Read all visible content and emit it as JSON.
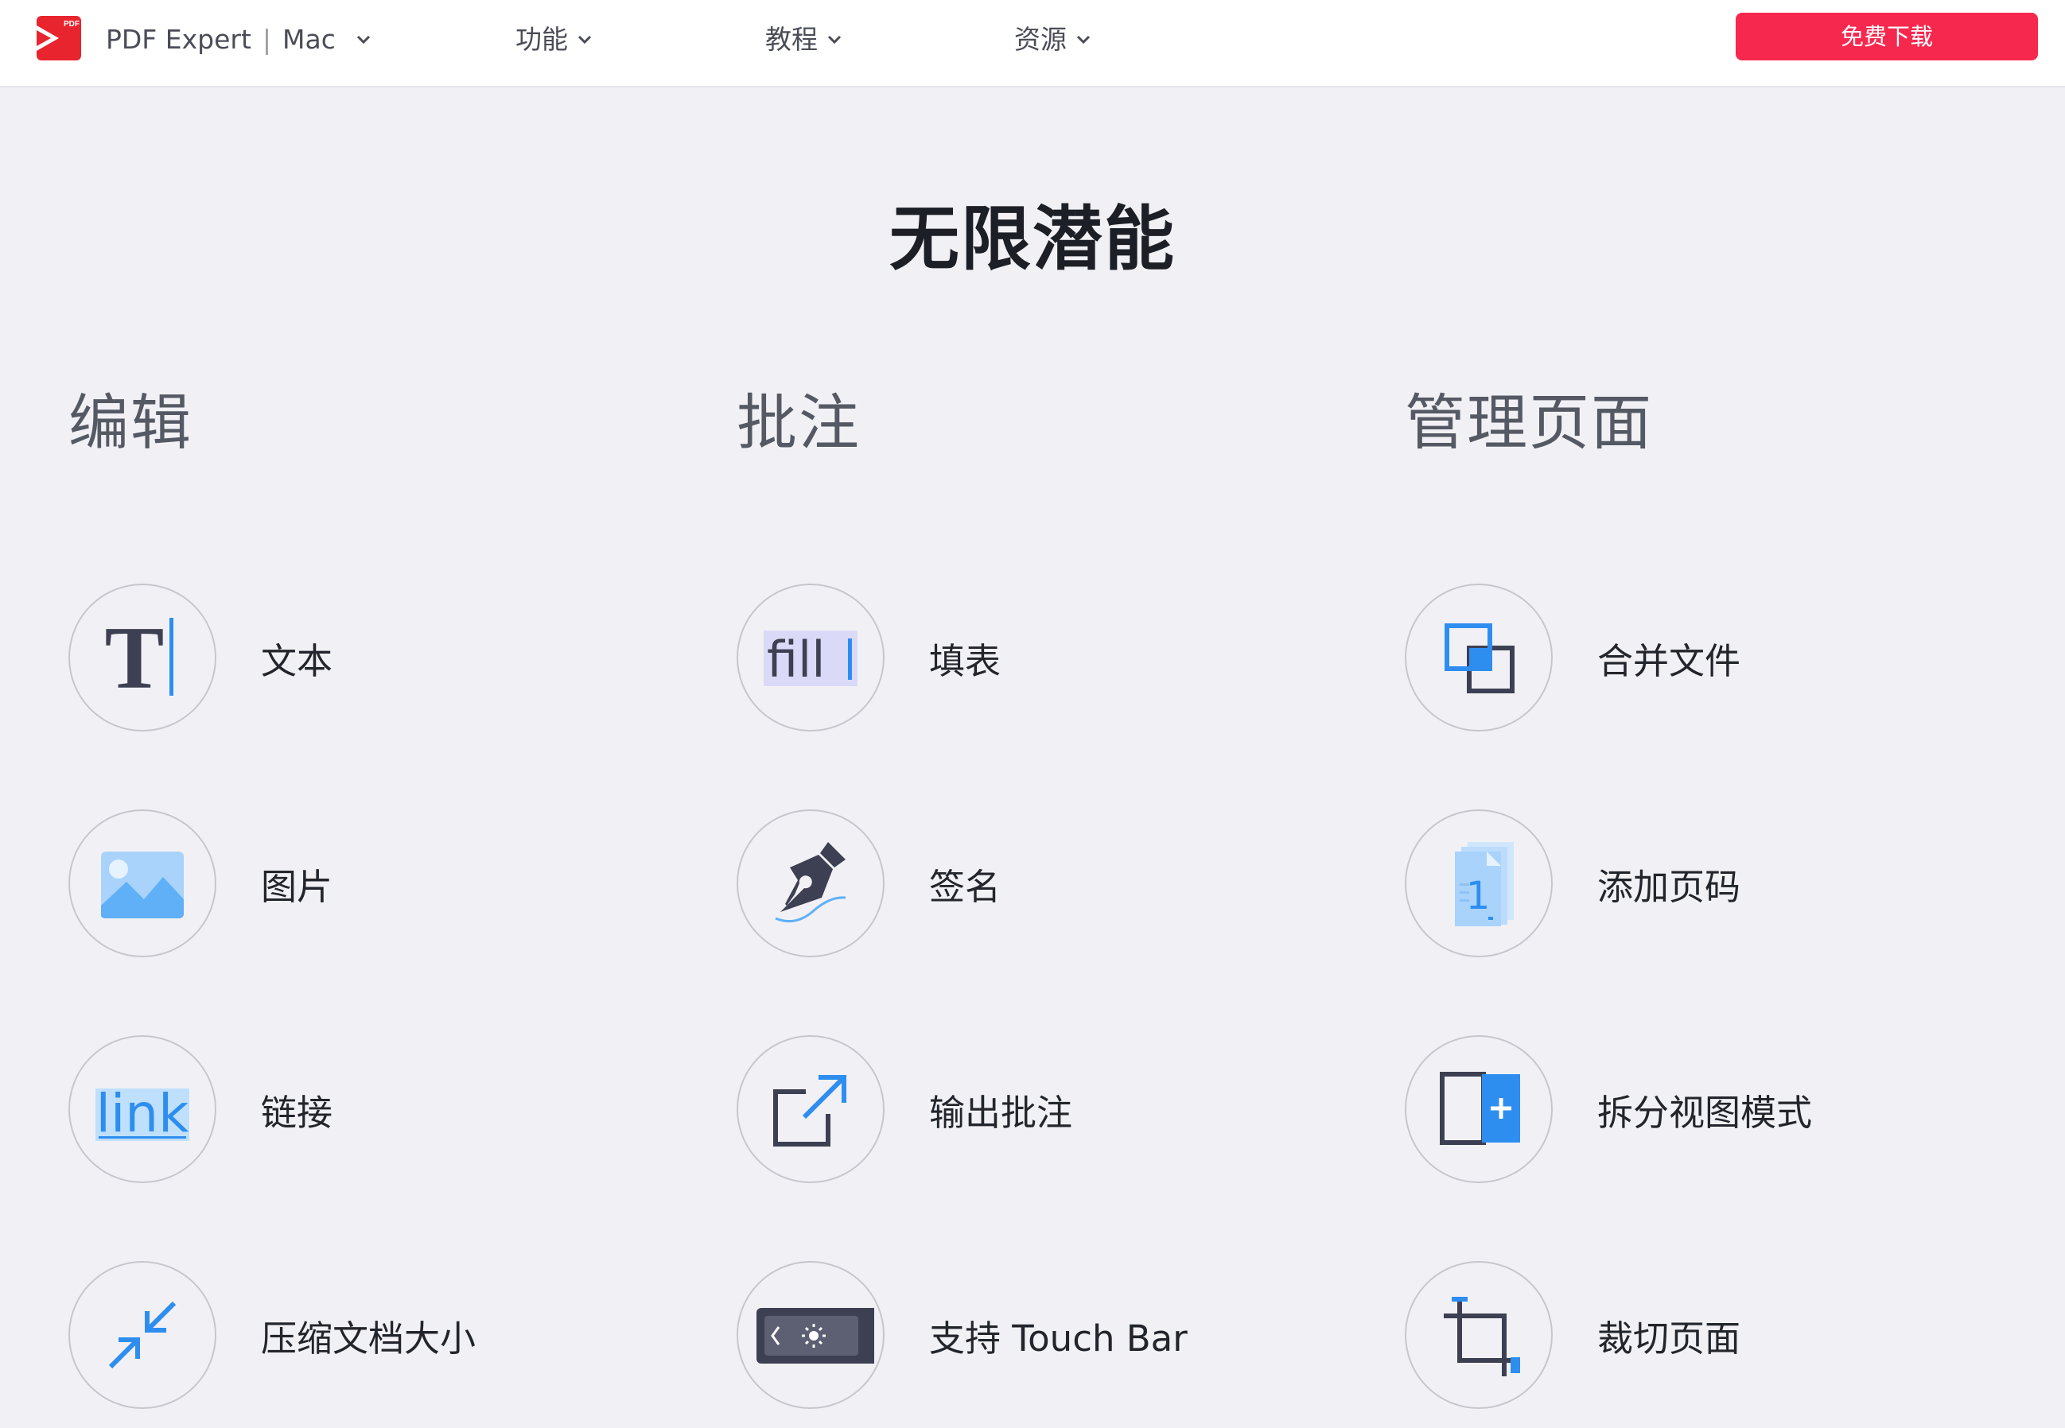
{
  "header": {
    "logo_label": "PDF",
    "brand": "PDF Expert",
    "platform": "Mac",
    "nav": [
      "功能",
      "教程",
      "资源"
    ],
    "download": "免费下载"
  },
  "page_title": "无限潜能",
  "columns": [
    {
      "heading": "编辑",
      "items": [
        {
          "label": "文本",
          "icon": "text-cursor-icon"
        },
        {
          "label": "图片",
          "icon": "image-icon"
        },
        {
          "label": "链接",
          "icon": "link-icon"
        },
        {
          "label": "压缩文档大小",
          "icon": "compress-icon"
        }
      ]
    },
    {
      "heading": "批注",
      "items": [
        {
          "label": "填表",
          "icon": "fill-form-icon"
        },
        {
          "label": "签名",
          "icon": "pen-nib-icon"
        },
        {
          "label": "输出批注",
          "icon": "export-icon"
        },
        {
          "label": "支持 Touch Bar",
          "icon": "touch-bar-icon"
        }
      ]
    },
    {
      "heading": "管理页面",
      "items": [
        {
          "label": "合并文件",
          "icon": "merge-icon"
        },
        {
          "label": "添加页码",
          "icon": "page-number-icon"
        },
        {
          "label": "拆分视图模式",
          "icon": "split-view-icon"
        },
        {
          "label": "裁切页面",
          "icon": "crop-icon"
        }
      ]
    }
  ],
  "icon_text": {
    "text_glyph": "T",
    "fill_word": "fill",
    "link_word": "link",
    "page_number": "1"
  },
  "colors": {
    "accent_blue": "#2e8ef0",
    "download_red": "#f7284e",
    "icon_dark": "#3d3f52",
    "background": "#f1f1f5"
  }
}
